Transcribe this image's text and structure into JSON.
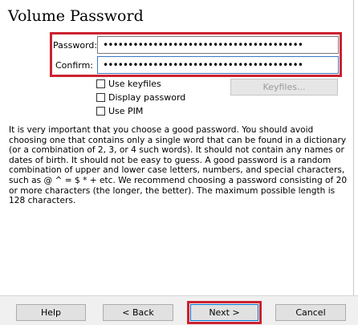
{
  "wizard": {
    "title": "Volume Password"
  },
  "form": {
    "password_label": "Password:",
    "password_value": "••••••••••••••••••••••••••••••••••••••••",
    "confirm_label": "Confirm:",
    "confirm_value": "••••••••••••••••••••••••••••••••••••••••",
    "use_keyfiles_label": "Use keyfiles",
    "display_password_label": "Display password",
    "use_pim_label": "Use PIM",
    "keyfiles_button_label": "Keyfiles..."
  },
  "description": "It is very important that you choose a good password. You should avoid choosing one that contains only a single word that can be found in a dictionary (or a combination of 2, 3, or 4 such words). It should not contain any names or dates of birth. It should not be easy to guess. A good password is a random combination of upper and lower case letters, numbers, and special characters, such as @ ^ = $ * + etc. We recommend choosing a password consisting of 20 or more characters (the longer, the better). The maximum possible length is 128 characters.",
  "buttons": {
    "help": "Help",
    "back": "< Back",
    "next": "Next >",
    "cancel": "Cancel"
  },
  "colors": {
    "highlight": "#cc2230",
    "focus_border": "#3c78c4"
  }
}
